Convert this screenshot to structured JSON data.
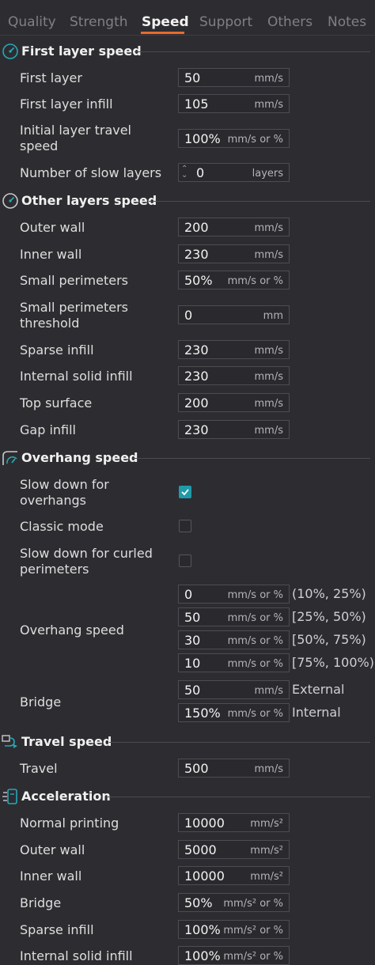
{
  "tabs": [
    "Quality",
    "Strength",
    "Speed",
    "Support",
    "Others",
    "Notes"
  ],
  "active_tab": "Speed",
  "accent_color": "#e96a2e",
  "checkbox_color": "#1f9aa8",
  "sections": {
    "first_layer": {
      "title": "First layer speed",
      "icon": "speedometer-icon",
      "first_layer": {
        "label": "First layer",
        "value": "50",
        "unit": "mm/s"
      },
      "first_layer_infill": {
        "label": "First layer infill",
        "value": "105",
        "unit": "mm/s"
      },
      "initial_travel": {
        "label": "Initial layer travel speed",
        "value": "100%",
        "unit": "mm/s or %"
      },
      "slow_layers": {
        "label": "Number of slow layers",
        "value": "0",
        "unit": "layers"
      }
    },
    "other_layers": {
      "title": "Other layers speed",
      "icon": "speedometer-icon",
      "outer_wall": {
        "label": "Outer wall",
        "value": "200",
        "unit": "mm/s"
      },
      "inner_wall": {
        "label": "Inner wall",
        "value": "230",
        "unit": "mm/s"
      },
      "small_perimeters": {
        "label": "Small perimeters",
        "value": "50%",
        "unit": "mm/s or %"
      },
      "small_perimeters_threshold": {
        "label": "Small perimeters threshold",
        "value": "0",
        "unit": "mm"
      },
      "sparse_infill": {
        "label": "Sparse infill",
        "value": "230",
        "unit": "mm/s"
      },
      "internal_solid_infill": {
        "label": "Internal solid infill",
        "value": "230",
        "unit": "mm/s"
      },
      "top_surface": {
        "label": "Top surface",
        "value": "200",
        "unit": "mm/s"
      },
      "gap_infill": {
        "label": "Gap infill",
        "value": "230",
        "unit": "mm/s"
      }
    },
    "overhang": {
      "title": "Overhang speed",
      "icon": "overhang-icon",
      "slow_down": {
        "label": "Slow down for overhangs",
        "checked": true
      },
      "classic_mode": {
        "label": "Classic mode",
        "checked": false
      },
      "curled": {
        "label": "Slow down for curled perimeters",
        "checked": false
      },
      "overhang_speed_label": "Overhang speed",
      "overhang_speeds": [
        {
          "value": "0",
          "unit": "mm/s or %",
          "range": "(10%, 25%)"
        },
        {
          "value": "50",
          "unit": "mm/s or %",
          "range": "[25%, 50%)"
        },
        {
          "value": "30",
          "unit": "mm/s or %",
          "range": "[50%, 75%)"
        },
        {
          "value": "10",
          "unit": "mm/s or %",
          "range": "[75%, 100%)"
        }
      ],
      "bridge_label": "Bridge",
      "bridge": [
        {
          "value": "50",
          "unit": "mm/s",
          "side": "External"
        },
        {
          "value": "150%",
          "unit": "mm/s or %",
          "side": "Internal"
        }
      ]
    },
    "travel": {
      "title": "Travel speed",
      "icon": "travel-icon",
      "travel": {
        "label": "Travel",
        "value": "500",
        "unit": "mm/s"
      }
    },
    "acceleration": {
      "title": "Acceleration",
      "icon": "acceleration-icon",
      "normal": {
        "label": "Normal printing",
        "value": "10000",
        "unit": "mm/s²"
      },
      "outer_wall": {
        "label": "Outer wall",
        "value": "5000",
        "unit": "mm/s²"
      },
      "inner_wall": {
        "label": "Inner wall",
        "value": "10000",
        "unit": "mm/s²"
      },
      "bridge": {
        "label": "Bridge",
        "value": "50%",
        "unit": "mm/s² or %"
      },
      "sparse_infill": {
        "label": "Sparse infill",
        "value": "100%",
        "unit": "mm/s² or %"
      },
      "internal_solid_infill": {
        "label": "Internal solid infill",
        "value": "100%",
        "unit": "mm/s² or %"
      }
    }
  }
}
